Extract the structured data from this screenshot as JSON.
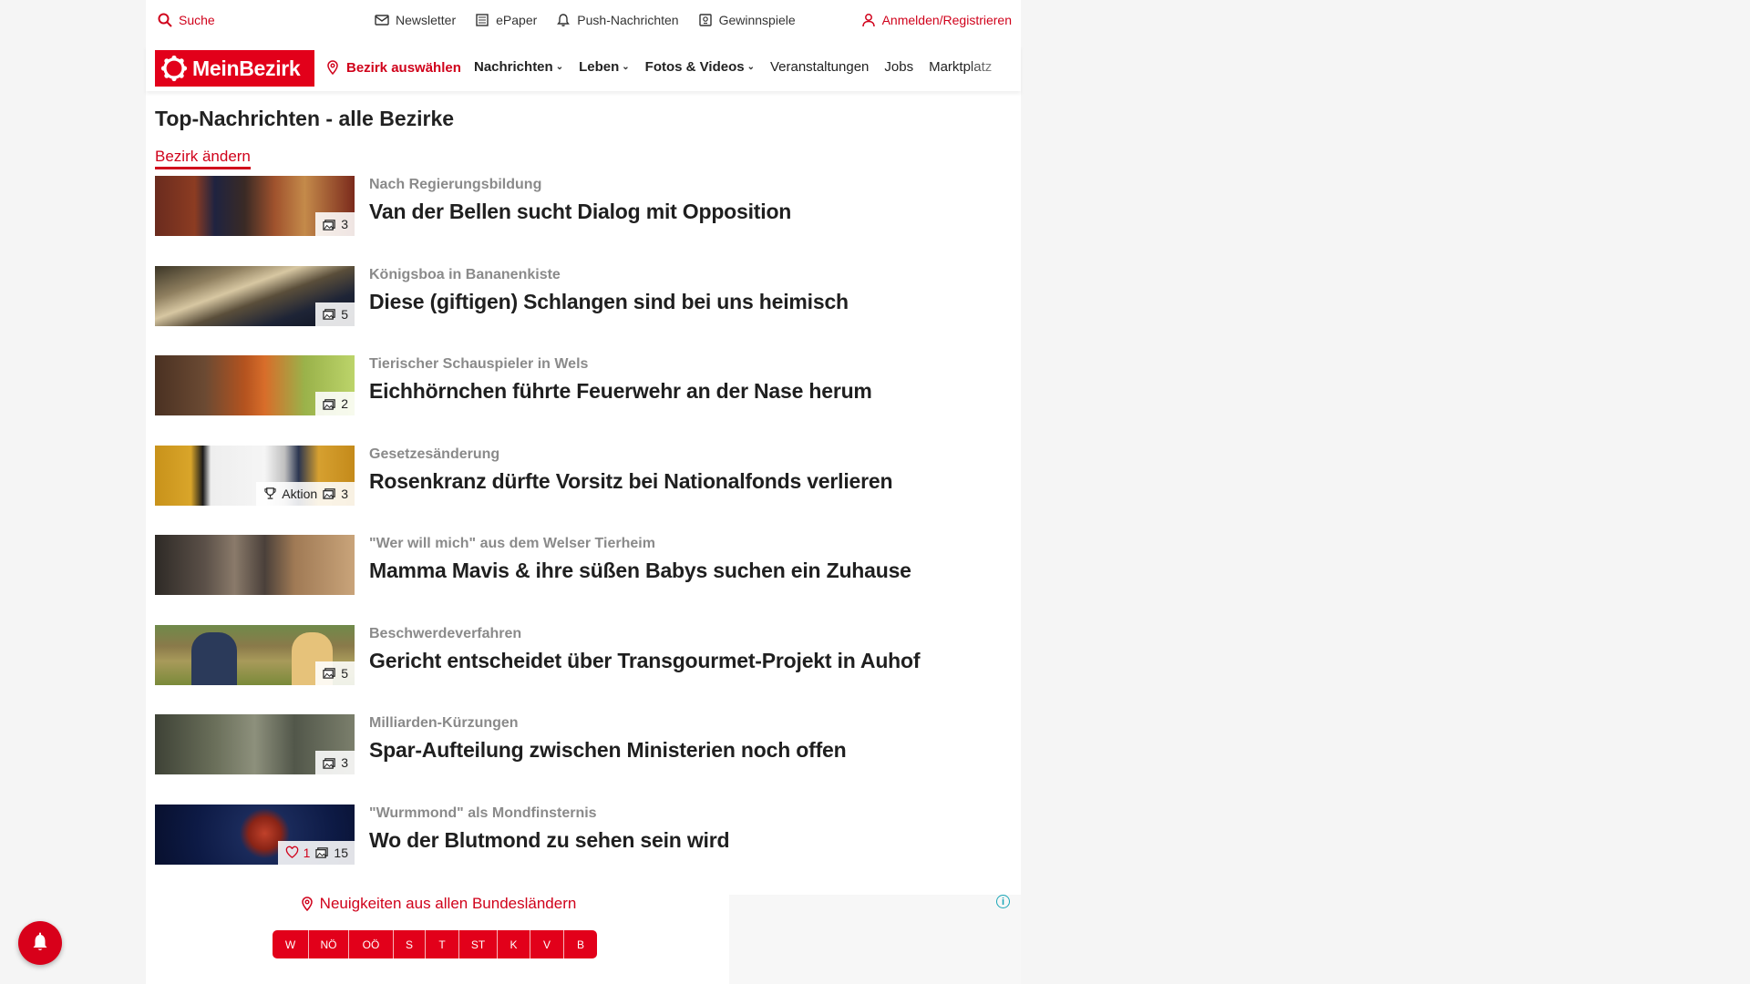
{
  "colors": {
    "brand": "#e2001a",
    "link": "#d0021b",
    "kicker": "#8a8a8a"
  },
  "utilbar": {
    "search": "Suche",
    "newsletter": "Newsletter",
    "epaper": "ePaper",
    "push": "Push-Nachrichten",
    "gewinnspiele": "Gewinnspiele",
    "login": "Anmelden/Registrieren"
  },
  "nav": {
    "logo": "MeinBezirk",
    "bezirk": "Bezirk auswählen",
    "items": [
      "Nachrichten",
      "Leben",
      "Fotos & Videos",
      "Veranstaltungen",
      "Jobs",
      "Marktplatz"
    ]
  },
  "page": {
    "title": "Top-Nachrichten - alle Bezirke",
    "change_link": "Bezirk ändern"
  },
  "articles": [
    {
      "kicker": "Nach Regierungsbildung",
      "headline": "Van der Bellen sucht Dialog mit Opposition",
      "photos": "3"
    },
    {
      "kicker": "Königsboa in Bananenkiste",
      "headline": "Diese (giftigen) Schlangen sind bei uns heimisch",
      "photos": "5"
    },
    {
      "kicker": "Tierischer Schauspieler in Wels",
      "headline": "Eichhörnchen führte Feuerwehr an der Nase herum",
      "photos": "2"
    },
    {
      "kicker": "Gesetzesänderung",
      "headline": "Rosenkranz dürfte Vorsitz bei Nationalfonds verlieren",
      "aktion": "Aktion",
      "photos": "3"
    },
    {
      "kicker": "\"Wer will mich\" aus dem Welser Tierheim",
      "headline": "Mamma Mavis & ihre süßen Babys suchen ein Zuhause"
    },
    {
      "kicker": "Beschwerdeverfahren",
      "headline": "Gericht entscheidet über Transgourmet-Projekt in Auhof",
      "photos": "5"
    },
    {
      "kicker": "Milliarden-Kürzungen",
      "headline": "Spar-Aufteilung zwischen Ministerien noch offen",
      "photos": "3"
    },
    {
      "kicker": "\"Wurmmond\" als Mondfinsternis",
      "headline": "Wo der Blutmond zu sehen sein wird",
      "likes": "1",
      "photos": "15"
    }
  ],
  "regions": {
    "label": "Neuigkeiten aus allen Bundesländern",
    "states": [
      "W",
      "NÖ",
      "OÖ",
      "S",
      "T",
      "ST",
      "K",
      "V",
      "B"
    ]
  },
  "ad": {
    "info": "i"
  }
}
